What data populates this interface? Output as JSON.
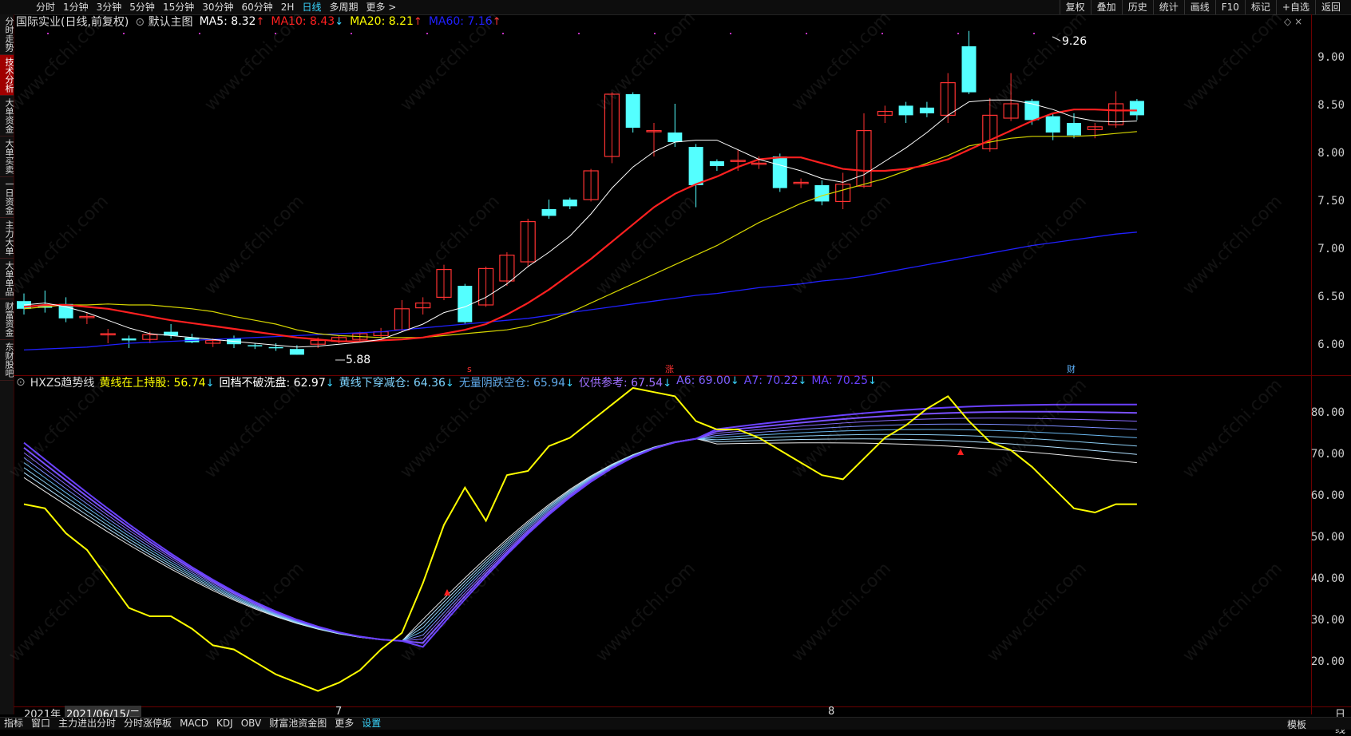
{
  "toolbar": {
    "periods": [
      "分时",
      "1分钟",
      "3分钟",
      "5分钟",
      "15分钟",
      "30分钟",
      "60分钟",
      "2H",
      "日线",
      "多周期",
      "更多 >"
    ],
    "active_period": "日线",
    "tools": [
      "复权",
      "叠加",
      "历史",
      "统计",
      "画线",
      "F10",
      "标记",
      "+自选",
      "返回"
    ]
  },
  "sidebar": {
    "tabs": [
      "分时走势",
      "技术分析",
      "大单资金",
      "大单买卖",
      "一日资金",
      "主力大单",
      "大单单品",
      "财富资金",
      "东财股吧"
    ],
    "active_tab": "技术分析"
  },
  "main_panel": {
    "stock_label": "国际实业(日线,前复权)",
    "template_label": "默认主图",
    "ma": [
      {
        "label": "MA5: 8.32",
        "arrow": "↑",
        "color": "#ffffff"
      },
      {
        "label": "MA10: 8.43",
        "arrow": "↓",
        "color": "#ff2020"
      },
      {
        "label": "MA20: 8.21",
        "arrow": "↑",
        "color": "#ffff00"
      },
      {
        "label": "MA60: 7.16",
        "arrow": "↑",
        "color": "#2020ff"
      }
    ],
    "high_label": "9.26",
    "low_label": "5.88",
    "markers": {
      "s": "s",
      "zhang": "涨",
      "cai": "财"
    },
    "price_axis": [
      "9.00",
      "8.50",
      "8.00",
      "7.50",
      "7.00",
      "6.50",
      "6.00"
    ]
  },
  "sub_panel": {
    "indicator_name": "HXZS趋势线",
    "items": [
      {
        "label": "黄线在上持股: 56.74",
        "arrow": "↓",
        "color": "#ffff00"
      },
      {
        "label": "回档不破洗盘: 62.97",
        "arrow": "↓",
        "color": "#ffffff"
      },
      {
        "label": "黄线下穿减仓: 64.36",
        "arrow": "↓",
        "color": "#7fd4ff"
      },
      {
        "label": "无量阴跌空仓: 65.94",
        "arrow": "↓",
        "color": "#5fa8e8"
      },
      {
        "label": "仅供参考: 67.54",
        "arrow": "↓",
        "color": "#a070ff"
      },
      {
        "label": "A6: 69.00",
        "arrow": "↓",
        "color": "#8060ff"
      },
      {
        "label": "A7: 70.22",
        "arrow": "↓",
        "color": "#7050ff"
      },
      {
        "label": "MA: 70.25",
        "arrow": "↓",
        "color": "#6a40ff"
      }
    ],
    "axis": [
      "80.00",
      "70.00",
      "60.00",
      "50.00",
      "40.00",
      "30.00",
      "20.00"
    ]
  },
  "date_bar": {
    "year": "2021年",
    "date": "2021/06/15/二",
    "month7": "7",
    "month8": "8",
    "period": "日线"
  },
  "bottom_tabs": [
    "指标",
    "窗口",
    "主力进出分时",
    "分时涨停板",
    "MACD",
    "KDJ",
    "OBV",
    "财富池资金图",
    "更多",
    "设置"
  ],
  "bottom_active": "设置",
  "bottom_right": "模板",
  "watermark": "www.cfchi.com",
  "colors": {
    "up": "#ff3232",
    "down": "#54ffff",
    "ma5": "#ffffff",
    "ma10": "#ff2020",
    "ma20": "#ffff00",
    "ma60": "#2020ff",
    "axis": "#6b0000"
  }
}
